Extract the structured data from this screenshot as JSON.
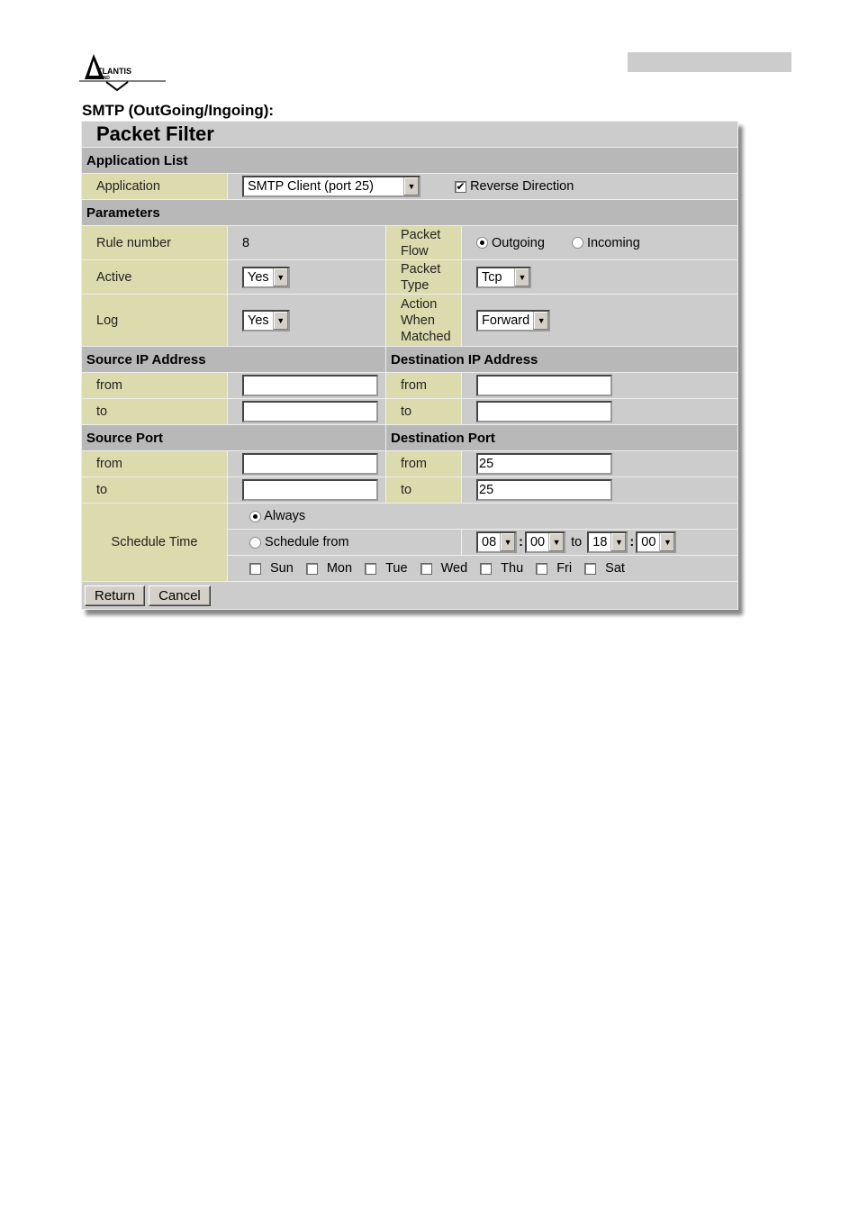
{
  "document": {
    "heading": "SMTP (OutGoing/Ingoing):",
    "brand": "ATLANTIS LAND"
  },
  "panel": {
    "title": "Packet Filter",
    "application_list": {
      "section": "Application List",
      "application_label": "Application",
      "application_value": "SMTP Client (port 25)",
      "reverse_direction_label": "Reverse Direction",
      "reverse_direction_checked": true
    },
    "parameters": {
      "section": "Parameters",
      "rule_number_label": "Rule number",
      "rule_number_value": "8",
      "packet_flow_label": "Packet Flow",
      "packet_flow_options": [
        "Outgoing",
        "Incoming"
      ],
      "packet_flow_selected": "Outgoing",
      "active_label": "Active",
      "active_value": "Yes",
      "packet_type_label": "Packet Type",
      "packet_type_value": "Tcp",
      "log_label": "Log",
      "log_value": "Yes",
      "action_label": "Action When Matched",
      "action_value": "Forward"
    },
    "source_ip": {
      "section": "Source IP Address",
      "from_label": "from",
      "from_value": "",
      "to_label": "to",
      "to_value": ""
    },
    "destination_ip": {
      "section": "Destination IP Address",
      "from_label": "from",
      "from_value": "",
      "to_label": "to",
      "to_value": ""
    },
    "source_port": {
      "section": "Source Port",
      "from_label": "from",
      "from_value": "",
      "to_label": "to",
      "to_value": ""
    },
    "destination_port": {
      "section": "Destination Port",
      "from_label": "from",
      "from_value": "25",
      "to_label": "to",
      "to_value": "25"
    },
    "schedule": {
      "label": "Schedule Time",
      "always_label": "Always",
      "schedule_from_label": "Schedule from",
      "selected": "Always",
      "start_hour": "08",
      "start_min": "00",
      "to_label": "to",
      "end_hour": "18",
      "end_min": "00",
      "colon": ":",
      "days": [
        "Sun",
        "Mon",
        "Tue",
        "Wed",
        "Thu",
        "Fri",
        "Sat"
      ]
    },
    "buttons": {
      "return": "Return",
      "cancel": "Cancel"
    }
  }
}
